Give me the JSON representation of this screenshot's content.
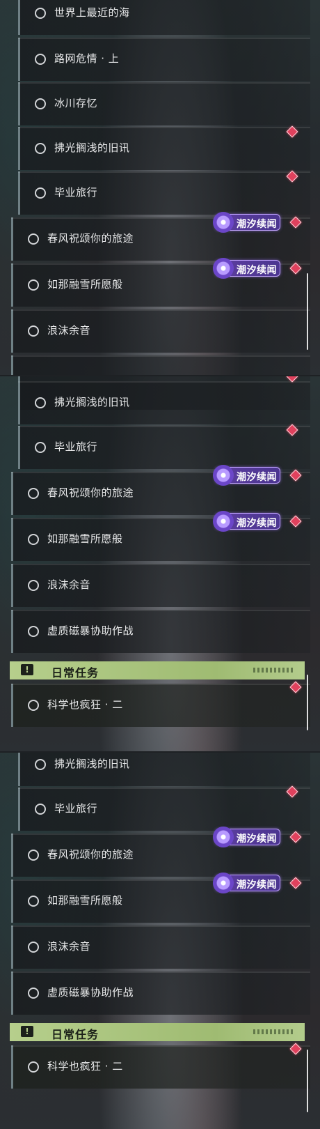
{
  "segments": [
    {
      "quests": [
        {
          "title": "世界上最近的海"
        },
        {
          "title": "路网危情 · 上"
        },
        {
          "title": "冰川存忆"
        },
        {
          "title": "拂光搁浅的旧讯"
        },
        {
          "title": "毕业旅行"
        },
        {
          "title": "春风祝颂你的旅途"
        },
        {
          "title": "如那融雪所愿般"
        },
        {
          "title": "浪沫余音"
        }
      ],
      "badges": [
        "潮汐续闻",
        "潮汐续闻"
      ]
    },
    {
      "quests": [
        {
          "title": "拂光搁浅的旧讯"
        },
        {
          "title": "毕业旅行"
        },
        {
          "title": "春风祝颂你的旅途"
        },
        {
          "title": "如那融雪所愿般"
        },
        {
          "title": "浪沫余音"
        },
        {
          "title": "虚质磁暴协助作战"
        },
        {
          "title": "科学也疯狂 · 二"
        }
      ],
      "badges": [
        "潮汐续闻",
        "潮汐续闻"
      ],
      "section": {
        "title": "日常任务",
        "icon": "!"
      }
    },
    {
      "quests": [
        {
          "title": "拂光搁浅的旧讯"
        },
        {
          "title": "毕业旅行"
        },
        {
          "title": "春风祝颂你的旅途"
        },
        {
          "title": "如那融雪所愿般"
        },
        {
          "title": "浪沫余音"
        },
        {
          "title": "虚质磁暴协助作战"
        },
        {
          "title": "科学也疯狂 · 二"
        }
      ],
      "badges": [
        "潮汐续闻",
        "潮汐续闻"
      ],
      "section": {
        "title": "日常任务",
        "icon": "!"
      }
    }
  ],
  "colors": {
    "accent_badge": "#5d3ea0",
    "gem": "#e0415d",
    "daily_header": "#b6cf8c"
  },
  "icons": {
    "badge": "tide-story-icon",
    "gem": "red-diamond-marker-icon",
    "quest": "quest-circle-icon",
    "daily": "exclamation-icon"
  }
}
